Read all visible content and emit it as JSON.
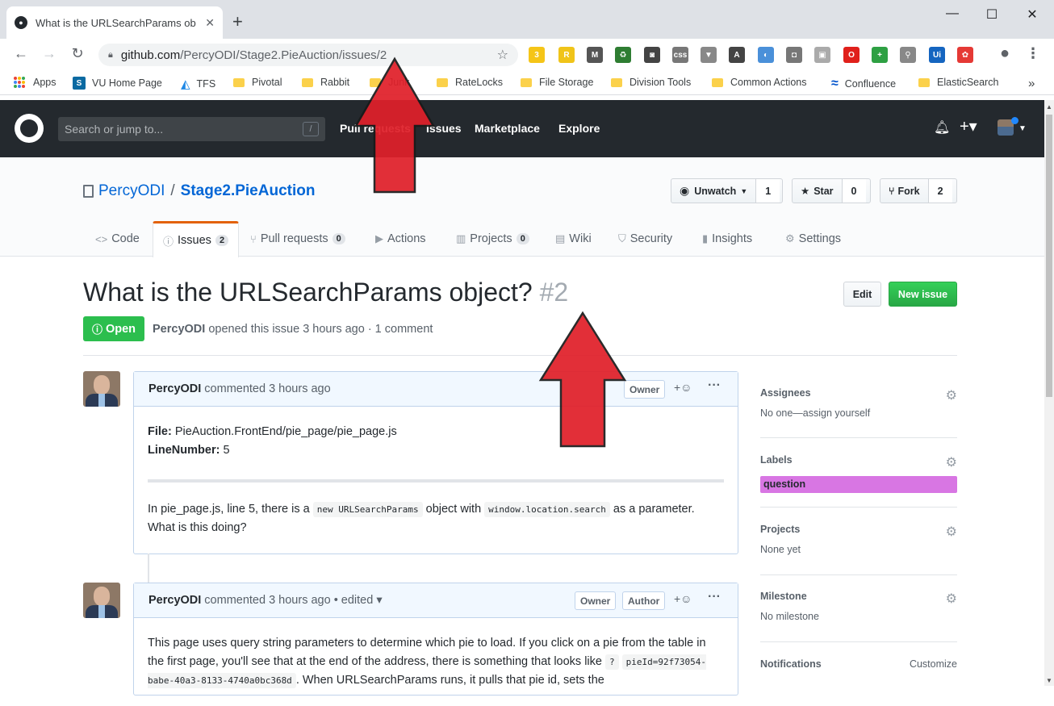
{
  "browser": {
    "tab_title": "What is the URLSearchParams ob",
    "url_host": "github.com",
    "url_path": "/PercyODI/Stage2.PieAuction/issues/2",
    "new_tab": "+",
    "extensions": [
      {
        "name": "ext-badge",
        "text": "3",
        "color": "#f5c518"
      },
      {
        "name": "ext-r",
        "text": "R",
        "color": "#f0c419"
      },
      {
        "name": "ext-m",
        "text": "M",
        "color": "#555555"
      },
      {
        "name": "ext-recycle",
        "text": "♻",
        "color": "#2e7d32"
      },
      {
        "name": "ext-shield",
        "text": "◙",
        "color": "#444444"
      },
      {
        "name": "ext-css",
        "text": "css",
        "color": "#777777"
      },
      {
        "name": "ext-v",
        "text": "▼",
        "color": "#888888"
      },
      {
        "name": "ext-a",
        "text": "A",
        "color": "#444444"
      },
      {
        "name": "ext-circle",
        "text": "◐",
        "color": "#4a90d9"
      },
      {
        "name": "ext-camera",
        "text": "◘",
        "color": "#777777"
      },
      {
        "name": "ext-book",
        "text": "▣",
        "color": "#aaaaaa"
      },
      {
        "name": "ext-opera",
        "text": "O",
        "color": "#e0201b"
      },
      {
        "name": "ext-plus",
        "text": "+",
        "color": "#2ea043"
      },
      {
        "name": "ext-search",
        "text": "⚲",
        "color": "#888888"
      },
      {
        "name": "ext-ui",
        "text": "Ui",
        "color": "#1565c0"
      },
      {
        "name": "ext-color",
        "text": "✿",
        "color": "#e53935"
      }
    ]
  },
  "bookmarks": [
    {
      "label": "Apps",
      "kind": "apps"
    },
    {
      "label": "VU Home Page",
      "kind": "sp"
    },
    {
      "label": "TFS",
      "kind": "tfs"
    },
    {
      "label": "Pivotal",
      "kind": "folder"
    },
    {
      "label": "Rabbit",
      "kind": "folder"
    },
    {
      "label": "Junk",
      "kind": "folder"
    },
    {
      "label": "RateLocks",
      "kind": "folder"
    },
    {
      "label": "File Storage",
      "kind": "folder"
    },
    {
      "label": "Division Tools",
      "kind": "folder"
    },
    {
      "label": "Common Actions",
      "kind": "folder"
    },
    {
      "label": "Confluence",
      "kind": "confluence"
    },
    {
      "label": "ElasticSearch",
      "kind": "folder"
    },
    {
      "label": "»",
      "kind": "more"
    }
  ],
  "gh": {
    "search_placeholder": "Search or jump to...",
    "search_key": "/",
    "nav": [
      "Pull requests",
      "Issues",
      "Marketplace",
      "Explore"
    ]
  },
  "repo": {
    "owner": "PercyODI",
    "separator": "/",
    "name": "Stage2.PieAuction",
    "watch_label": "Unwatch",
    "watch_count": "1",
    "star_label": "Star",
    "star_count": "0",
    "fork_label": "Fork",
    "fork_count": "2",
    "tabs": [
      {
        "label": "Code",
        "icon": "<>",
        "counter": ""
      },
      {
        "label": "Issues",
        "icon": "ⓘ",
        "counter": "2"
      },
      {
        "label": "Pull requests",
        "icon": "⑂",
        "counter": "0"
      },
      {
        "label": "Actions",
        "icon": "▶",
        "counter": ""
      },
      {
        "label": "Projects",
        "icon": "▥",
        "counter": "0"
      },
      {
        "label": "Wiki",
        "icon": "▤",
        "counter": ""
      },
      {
        "label": "Security",
        "icon": "⛉",
        "counter": ""
      },
      {
        "label": "Insights",
        "icon": "▮",
        "counter": ""
      },
      {
        "label": "Settings",
        "icon": "⚙",
        "counter": ""
      }
    ]
  },
  "issue": {
    "title": "What is the URLSearchParams object?",
    "number": "#2",
    "edit_label": "Edit",
    "new_label": "New issue",
    "state": "Open",
    "author": "PercyODI",
    "meta": "opened this issue 3 hours ago · 1 comment"
  },
  "comments": [
    {
      "author": "PercyODI",
      "when": "commented 3 hours ago",
      "badges": [
        "Owner"
      ],
      "file_label": "File:",
      "file_value": "PieAuction.FrontEnd/pie_page/pie_page.js",
      "line_label": "LineNumber:",
      "line_value": "5",
      "p1": "In pie_page.js, line 5, there is a",
      "code1": "new URLSearchParams",
      "p2": "object with",
      "code2": "window.location.search",
      "p3": "as a parameter. What is this doing?"
    },
    {
      "author": "PercyODI",
      "when": "commented 3 hours ago • edited ▾",
      "badges": [
        "Owner",
        "Author"
      ],
      "p1": "This page uses query string parameters to determine which pie to load. If you click on a pie from the table in the first page, you'll see that at the end of the address, there is something that looks like",
      "code1": "?",
      "code2": "pieId=92f73054-babe-40a3-8133-4740a0bc368d",
      "p2": ". When URLSearchParams runs, it pulls that pie id, sets the"
    }
  ],
  "sidebar": {
    "assignees_h": "Assignees",
    "assignees_v": "No one—assign yourself",
    "labels_h": "Labels",
    "label_q": "question",
    "label_color": "#d876e3",
    "projects_h": "Projects",
    "projects_v": "None yet",
    "milestone_h": "Milestone",
    "milestone_v": "No milestone",
    "notifications_h": "Notifications",
    "customize": "Customize"
  },
  "colors": {
    "accent": "#0366d6",
    "open": "#2cbe4e",
    "arrow": "#e0202a"
  }
}
